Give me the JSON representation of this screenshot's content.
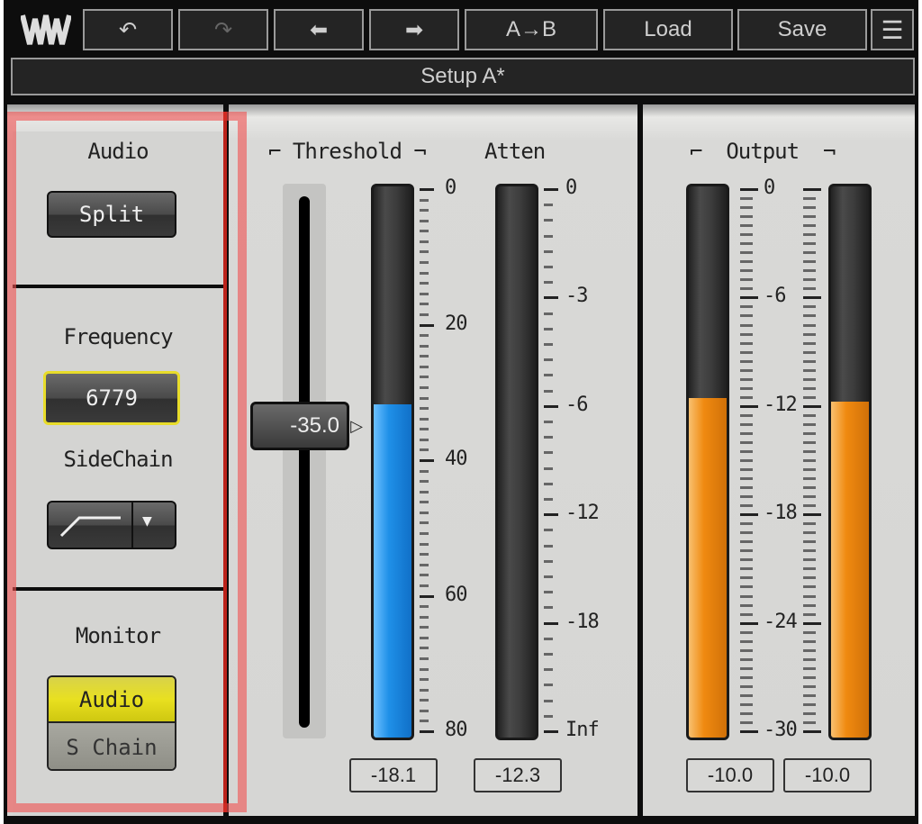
{
  "toolbar": {
    "logo": "waves-logo",
    "undo": "undo-icon",
    "redo": "redo-icon",
    "prev": "arrow-left-icon",
    "next": "arrow-right-icon",
    "ab_label": "A→B",
    "load_label": "Load",
    "save_label": "Save",
    "menu": "hamburger-menu-icon"
  },
  "setup": {
    "label": "Setup A*"
  },
  "left_panel": {
    "audio": {
      "title": "Audio",
      "button": "Split"
    },
    "frequency": {
      "title": "Frequency",
      "value": "6779"
    },
    "sidechain": {
      "title": "SideChain",
      "filter": "high-shelf-curve-icon",
      "dropdown": "triangle-down-icon"
    },
    "monitor": {
      "title": "Monitor",
      "options": [
        "Audio",
        "S Chain"
      ],
      "selected": "Audio"
    }
  },
  "threshold": {
    "title": "Threshold",
    "slider_value": "-35.0",
    "slider_fraction": 0.4375,
    "meter_scale": [
      "0",
      "20",
      "40",
      "60",
      "80"
    ],
    "meter_level_db": 31.6,
    "meter_range": [
      0,
      80
    ],
    "readout": "-18.1",
    "color": "#1e8fe0"
  },
  "atten": {
    "title": "Atten",
    "meter_scale": [
      "0",
      "-3",
      "-6",
      "-12",
      "-18",
      "Inf"
    ],
    "readout": "-12.3"
  },
  "output": {
    "title": "Output",
    "meter_scale": [
      "0",
      "-6",
      "-12",
      "-18",
      "-24",
      "-30"
    ],
    "meter_range": [
      0,
      -30
    ],
    "left_level_db": -11.5,
    "right_level_db": -11.7,
    "readout_left": "-10.0",
    "readout_right": "-10.0",
    "color": "#f08a10"
  }
}
